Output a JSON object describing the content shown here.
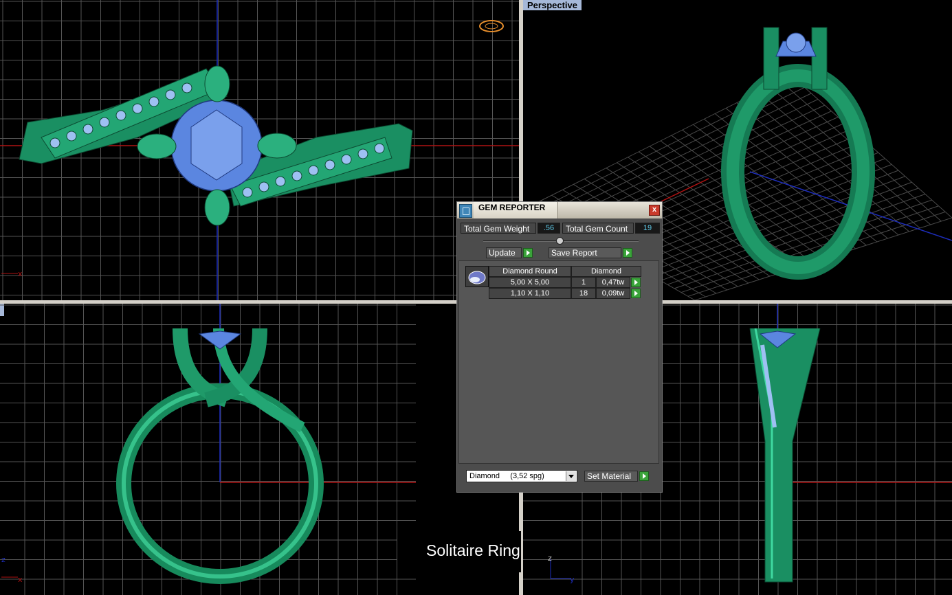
{
  "viewports": {
    "perspective_label": "Perspective",
    "axis_x": "x",
    "axis_y": "y",
    "axis_z": "z"
  },
  "caption": "Solitaire Ring",
  "gem_reporter": {
    "title": "GEM REPORTER",
    "close_glyph": "x",
    "total_weight_label": "Total Gem Weight",
    "total_weight_value": ".56",
    "total_count_label": "Total Gem Count",
    "total_count_value": "19",
    "update_label": "Update",
    "save_report_label": "Save Report",
    "table_header": {
      "shape": "Diamond Round",
      "material": "Diamond"
    },
    "rows": [
      {
        "size": "5,00 X 5,00",
        "qty": "1",
        "weight": "0,47tw"
      },
      {
        "size": "1,10 X 1,10",
        "qty": "18",
        "weight": "0,09tw"
      }
    ],
    "material_select": "Diamond     (3,52 spg)",
    "set_material_label": "Set Material"
  },
  "colors": {
    "metal": "#1e9b6a",
    "gem": "#5b86e0",
    "grid": "#5a5a5a",
    "axis_red": "#b01212",
    "axis_blue": "#1d2dbd"
  }
}
